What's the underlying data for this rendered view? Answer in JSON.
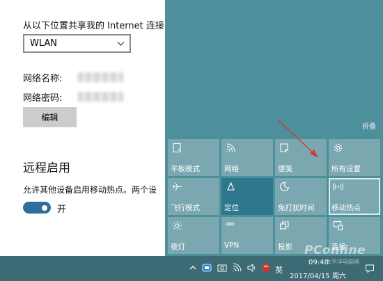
{
  "settings": {
    "share_label": "从以下位置共享我的 Internet 连接",
    "dropdown_value": "WLAN",
    "network_name_label": "网络名称:",
    "network_password_label": "网络密码:",
    "edit_button": "编辑",
    "remote_title": "远程启用",
    "allow_text": "允许其他设备启用移动热点。两个设",
    "toggle_label": "开",
    "toggle_on": true
  },
  "action_center": {
    "collapse_label": "折叠",
    "tiles": [
      {
        "label": "平板模式",
        "icon": "tablet-mode-icon",
        "active": false
      },
      {
        "label": "网络",
        "icon": "network-icon",
        "active": false
      },
      {
        "label": "便笺",
        "icon": "note-icon",
        "active": false
      },
      {
        "label": "所有设置",
        "icon": "settings-gear-icon",
        "active": false
      },
      {
        "label": "飞行模式",
        "icon": "airplane-icon",
        "active": false
      },
      {
        "label": "定位",
        "icon": "location-icon",
        "active": true
      },
      {
        "label": "免打扰时间",
        "icon": "moon-icon",
        "active": false
      },
      {
        "label": "移动热点",
        "icon": "hotspot-icon",
        "active": false,
        "outlined": true
      },
      {
        "label": "夜灯",
        "icon": "brightness-icon",
        "active": false
      },
      {
        "label": "VPN",
        "icon": "vpn-icon",
        "active": false
      },
      {
        "label": "投影",
        "icon": "project-icon",
        "active": false
      },
      {
        "label": "连接",
        "icon": "connect-icon",
        "active": false
      }
    ],
    "accent_color": "#2e788e",
    "tile_color": "#7aa7b0"
  },
  "taskbar": {
    "time": "09:48",
    "date": "2017/04/15 周六",
    "ime": "英"
  },
  "watermark": {
    "brand": "PConline",
    "sub": "太平洋电脑网"
  }
}
